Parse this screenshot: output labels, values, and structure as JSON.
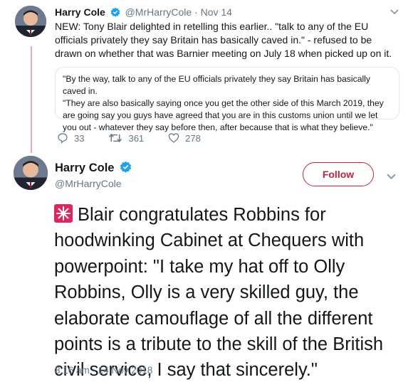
{
  "tweet1": {
    "name": "Harry Cole",
    "handle": "@MrHarryCole",
    "time": "Nov 14",
    "text": "NEW: Tony Blair delighted in retelling this earlier.. \"talk to any of the EU officials privately they say Britain has basically caved in.\" - refused to be drawn on whether that was Barnier meeting on July 18 when picked up on it.",
    "quote": {
      "line1": "\"By the way, talk to any of the EU officials privately they say Britain has basically caved in.",
      "line2": "\"They are also basically saying once you get the other side of this March 2019, they are going say you guys have agreed that you are in this customs union until we let you out - whatever they say before then, after because that is what they believe.\""
    },
    "actions": {
      "replies": "33",
      "retweets": "361",
      "likes": "278"
    }
  },
  "tweet2": {
    "name": "Harry Cole",
    "handle": "@MrHarryCole",
    "follow_label": "Follow",
    "text": "Blair congratulates Robbins for hoodwinking Cabinet at Chequers with powerpoint: \"I take my hat off to Olly Robbins, Olly is a very skilled guy, the elaborate camouflage of all the different points is a tribute to the skill of the British civil service, I say that sincerely.\"",
    "timestamp": "8:16 am - 14 Nov 2018",
    "emoji": "siren-icon"
  },
  "colors": {
    "accent": "#c0253f",
    "verified": "#1da1f2",
    "secondary_text": "#657786",
    "thread_line": "#e8a6c0"
  }
}
